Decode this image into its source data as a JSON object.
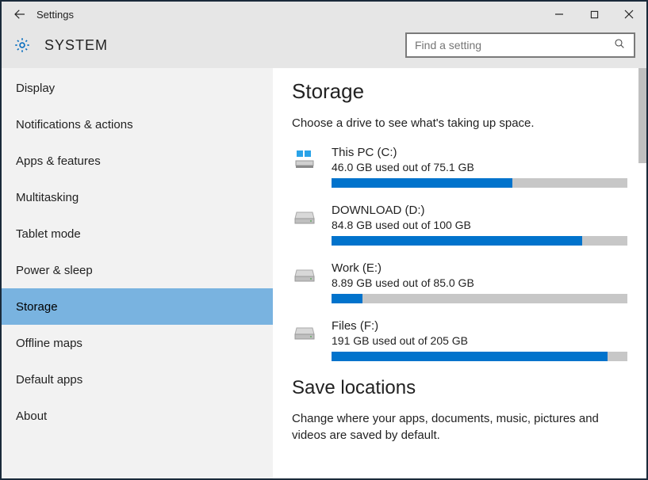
{
  "titlebar": {
    "title": "Settings"
  },
  "header": {
    "system_label": "SYSTEM",
    "search_placeholder": "Find a setting"
  },
  "sidebar": {
    "items": [
      {
        "label": "Display",
        "selected": false
      },
      {
        "label": "Notifications & actions",
        "selected": false
      },
      {
        "label": "Apps & features",
        "selected": false
      },
      {
        "label": "Multitasking",
        "selected": false
      },
      {
        "label": "Tablet mode",
        "selected": false
      },
      {
        "label": "Power & sleep",
        "selected": false
      },
      {
        "label": "Storage",
        "selected": true
      },
      {
        "label": "Offline maps",
        "selected": false
      },
      {
        "label": "Default apps",
        "selected": false
      },
      {
        "label": "About",
        "selected": false
      }
    ]
  },
  "main": {
    "heading": "Storage",
    "subheading": "Choose a drive to see what's taking up space.",
    "drives": [
      {
        "name": "This PC (C:)",
        "usage_text": "46.0 GB used out of 75.1 GB",
        "used": 46.0,
        "total": 75.1,
        "system": true
      },
      {
        "name": "DOWNLOAD (D:)",
        "usage_text": "84.8 GB used out of 100 GB",
        "used": 84.8,
        "total": 100,
        "system": false
      },
      {
        "name": "Work (E:)",
        "usage_text": "8.89 GB used out of 85.0 GB",
        "used": 8.89,
        "total": 85.0,
        "system": false
      },
      {
        "name": "Files (F:)",
        "usage_text": "191 GB used out of 205 GB",
        "used": 191,
        "total": 205,
        "system": false
      }
    ],
    "save_heading": "Save locations",
    "save_desc": "Change where your apps, documents, music, pictures and videos are saved by default."
  }
}
